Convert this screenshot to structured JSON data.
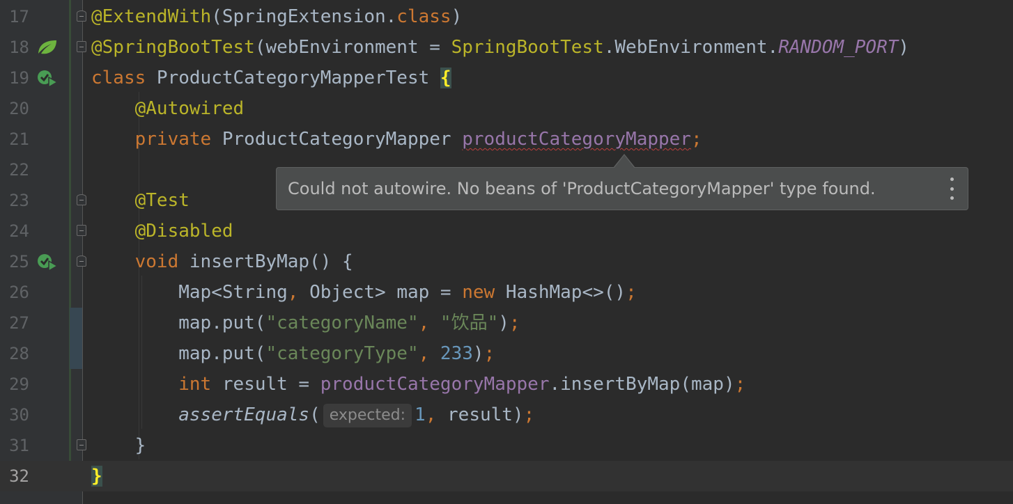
{
  "editor": {
    "lines": [
      {
        "n": "17"
      },
      {
        "n": "18"
      },
      {
        "n": "19"
      },
      {
        "n": "20"
      },
      {
        "n": "21"
      },
      {
        "n": "22"
      },
      {
        "n": "23"
      },
      {
        "n": "24"
      },
      {
        "n": "25"
      },
      {
        "n": "26"
      },
      {
        "n": "27"
      },
      {
        "n": "28"
      },
      {
        "n": "29"
      },
      {
        "n": "30"
      },
      {
        "n": "31"
      },
      {
        "n": "32"
      }
    ],
    "code": {
      "l17": {
        "ann": "@ExtendWith",
        "p1": "(SpringExtension.",
        "kw": "class",
        "p2": ")"
      },
      "l18": {
        "ann": "@SpringBootTest",
        "p1": "(webEnvironment = ",
        "ann2": "SpringBootTest",
        "p2": ".WebEnvironment.",
        "fld": "RANDOM_PORT",
        "p3": ")"
      },
      "l19": {
        "kw": "class",
        "name": " ProductCategoryMapperTest ",
        "brace": "{"
      },
      "l20": {
        "ann": "@Autowired"
      },
      "l21": {
        "kw": "private",
        "type": " ProductCategoryMapper ",
        "fld": "productCategoryMapper",
        "semi": ";"
      },
      "l23": {
        "ann": "@Test"
      },
      "l24": {
        "ann": "@Disabled"
      },
      "l25": {
        "kw": "void",
        "name": " insertByMap() {"
      },
      "l26": {
        "p1": "Map<String",
        "c1": ",",
        "p2": " Object> map = ",
        "kw": "new",
        "p3": " HashMap<>()",
        "semi": ";"
      },
      "l27": {
        "p1": "map.put(",
        "s1": "\"categoryName\"",
        "c1": ",",
        "s2": " \"饮品\"",
        "p2": ")",
        "semi": ";"
      },
      "l28": {
        "p1": "map.put(",
        "s1": "\"categoryType\"",
        "c1": ",",
        "num": " 233",
        "p2": ")",
        "semi": ";"
      },
      "l29": {
        "kw": "int",
        "p1": " result = ",
        "fld": "productCategoryMapper",
        "p2": ".insertByMap(map)",
        "semi": ";"
      },
      "l30": {
        "fn": "assertEquals",
        "p1": "(",
        "hint": "expected:",
        "num": "1",
        "c1": ",",
        "p2": " result)",
        "semi": ";"
      },
      "l31": {
        "p1": "}"
      },
      "l32": {
        "brace": "}"
      }
    }
  },
  "tooltip": {
    "message": "Could not autowire. No beans of 'ProductCategoryMapper' type found."
  },
  "icons": {
    "spring": "spring-leaf-icon",
    "run": "run-test-icon",
    "more": "more-vertical-icon"
  },
  "colors": {
    "background": "#2b2b2b",
    "annotation": "#bbb529",
    "keyword": "#cc7832",
    "string": "#6a8759",
    "number": "#6897bb",
    "field": "#9876aa",
    "error_underline": "#bc3f3c"
  }
}
